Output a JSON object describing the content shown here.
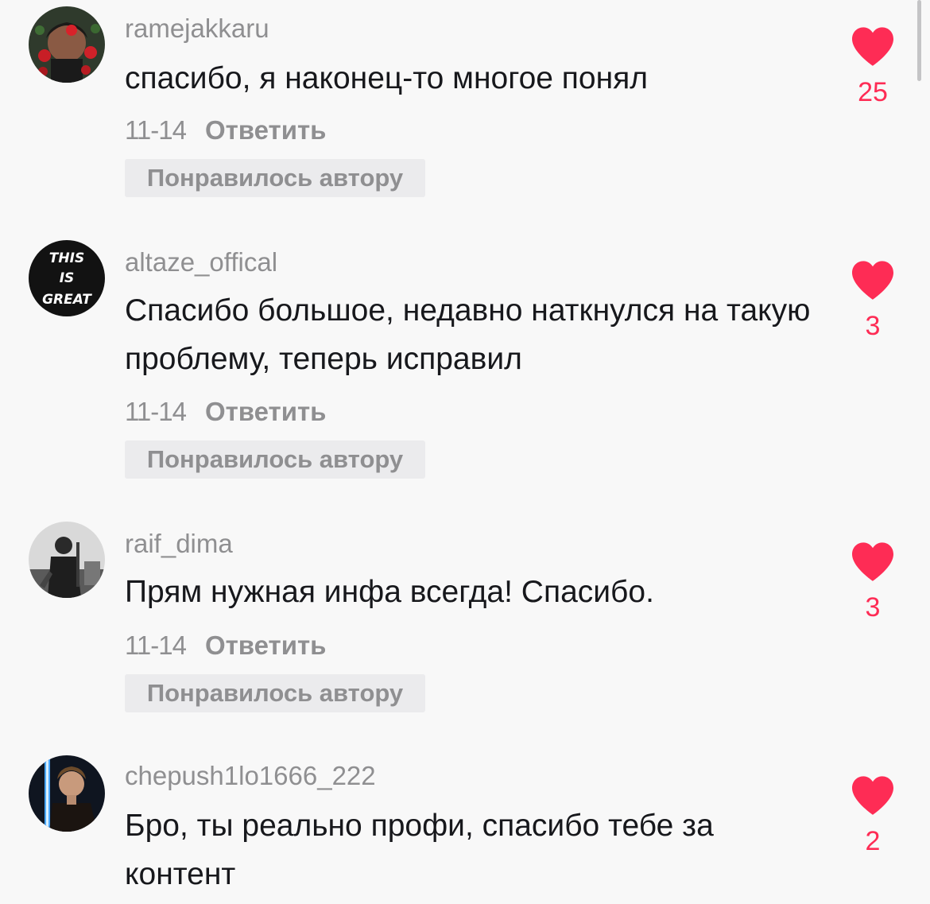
{
  "colors": {
    "background": "#f8f8f8",
    "username": "#8f8f91",
    "text": "#17181c",
    "like_accent": "#fe2c55",
    "badge_bg": "#ebebed"
  },
  "comments": [
    {
      "username": "ramejakkaru",
      "text": "спасибо, я наконец-то многое понял",
      "date": "11-14",
      "reply_label": "Ответить",
      "badge": "Понравилось автору",
      "likes": "25",
      "avatar_icon": "avatar-portrait-roses"
    },
    {
      "username": "altaze_offical",
      "text": "Спасибо большое, недавно наткнулся на такую проблему, теперь исправил",
      "date": "11-14",
      "reply_label": "Ответить",
      "badge": "Понравилось автору",
      "likes": "3",
      "avatar_icon": "avatar-this-is-great",
      "avatar_text": [
        "THIS",
        "IS",
        "GREAT"
      ]
    },
    {
      "username": "raif_dima",
      "text": "Прям нужная инфа всегда! Спасибо.",
      "date": "11-14",
      "reply_label": "Ответить",
      "badge": "Понравилось автору",
      "likes": "3",
      "avatar_icon": "avatar-bw-musician"
    },
    {
      "username": "chepush1lo1666_222",
      "text": "Бро, ты реально профи, спасибо тебе за контент",
      "likes": "2",
      "avatar_icon": "avatar-portrait-lightsaber"
    }
  ]
}
